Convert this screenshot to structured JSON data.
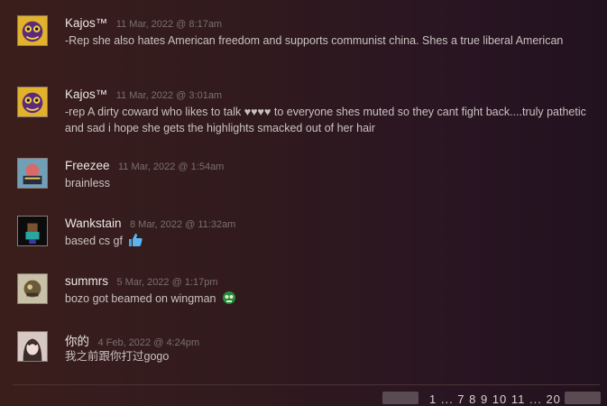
{
  "comments": [
    {
      "author": "Kajos™",
      "date": "11 Mar, 2022 @ 8:17am",
      "text": "-Rep she also hates American freedom and supports communist china. Shes a true liberal American"
    },
    {
      "author": "Kajos™",
      "date": "11 Mar, 2022 @ 3:01am",
      "text": "-rep A dirty coward who likes to talk ♥♥♥♥ to everyone shes muted so they cant fight back....truly pathetic and sad i hope she gets the highlights smacked out of her hair"
    },
    {
      "author": "Freezee",
      "date": "11 Mar, 2022 @ 1:54am",
      "text": "brainless"
    },
    {
      "author": "Wankstain",
      "date": "8 Mar, 2022 @ 11:32am",
      "text": "based cs gf",
      "emote": "thumbs-up-emote"
    },
    {
      "author": "summrs",
      "date": "5 Mar, 2022 @ 1:17pm",
      "text": "bozo got beamed on wingman",
      "emote": "green-skull-emote"
    },
    {
      "author": "你的",
      "date": "4 Feb, 2022 @ 4:24pm",
      "text": "我之前跟你打过gogo"
    }
  ],
  "pagination": {
    "pages": "1 ... 7  8  9  10  11 ... 20"
  },
  "colors": {
    "author": "#ece8e6",
    "date": "#7a7070",
    "text": "#c9c2c0",
    "background": "#2e171f"
  }
}
